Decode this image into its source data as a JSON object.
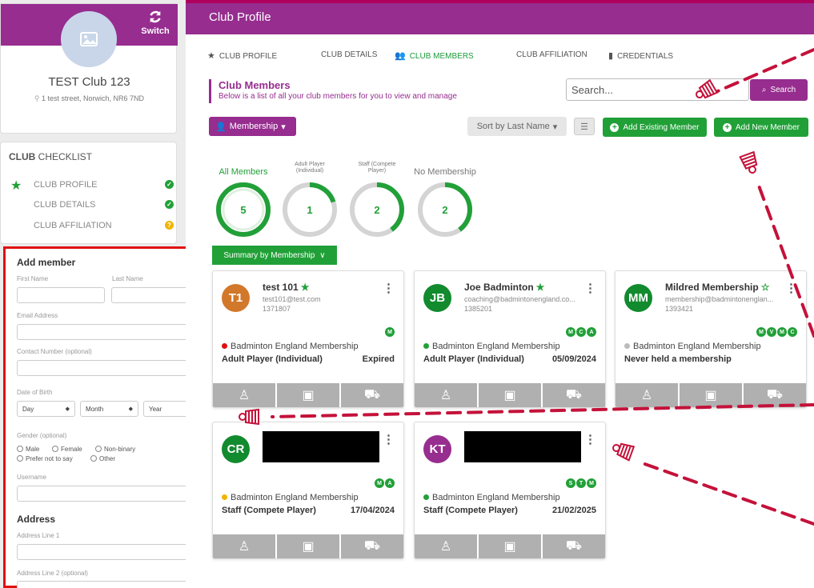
{
  "sidebar": {
    "switch_label": "Switch",
    "club_name": "TEST Club 123",
    "club_address": "1 test street, Norwich, NR6 7ND",
    "checklist_title_bold": "CLUB",
    "checklist_title_rest": " CHECKLIST",
    "checklist": [
      {
        "label": "CLUB PROFILE",
        "status": "complete"
      },
      {
        "label": "CLUB DETAILS",
        "status": "complete"
      },
      {
        "label": "CLUB AFFILIATION",
        "status": "pending"
      }
    ]
  },
  "add_member": {
    "title": "Add member",
    "first_name": "First Name",
    "last_name": "Last Name",
    "email": "Email Address",
    "contact": "Contact Number (optional)",
    "dob": "Date of Birth",
    "day": "Day",
    "month": "Month",
    "year": "Year",
    "gender": "Gender (optional)",
    "gender_options": [
      "Male",
      "Female",
      "Non-binary",
      "Prefer not to say",
      "Other"
    ],
    "username": "Username",
    "address_title": "Address",
    "address1": "Address Line 1",
    "address2": "Address Line 2 (optional)"
  },
  "header": {
    "title": "Club Profile"
  },
  "tabs": [
    {
      "label": "CLUB PROFILE",
      "icon": "star-icon",
      "active": false
    },
    {
      "label": "CLUB DETAILS",
      "icon": "",
      "active": false
    },
    {
      "label": "CLUB MEMBERS",
      "icon": "users-icon",
      "active": true
    },
    {
      "label": "CLUB AFFILIATION",
      "icon": "",
      "active": false
    },
    {
      "label": "CREDENTIALS",
      "icon": "bookmark-icon",
      "active": false
    }
  ],
  "section": {
    "title": "Club Members",
    "subtitle": "Below is a list of all your club members for you to view and manage"
  },
  "search": {
    "placeholder": "Search...",
    "button": "Search"
  },
  "toolbar": {
    "membership": "Membership",
    "sort": "Sort by Last Name",
    "add_existing": "Add Existing Member",
    "add_new": "Add New Member"
  },
  "stats": [
    {
      "label": "All Members",
      "value": "5",
      "fraction": 1.0
    },
    {
      "label": "Adult Player (Individual)",
      "value": "1",
      "fraction": 0.2
    },
    {
      "label": "Staff (Compete Player)",
      "value": "2",
      "fraction": 0.4
    },
    {
      "label": "No Membership",
      "value": "2",
      "fraction": 0.4
    }
  ],
  "summary_button": "Summary by Membership",
  "members": [
    {
      "initials": "T1",
      "avatar_color": "#d2782a",
      "name": "test 101",
      "starred": true,
      "email": "test101@test.com",
      "id": "1371807",
      "badges": [
        "M"
      ],
      "status_color": "#e01010",
      "membership": "Badminton England Membership",
      "type": "Adult Player (Individual)",
      "date": "Expired",
      "redacted": false
    },
    {
      "initials": "JB",
      "avatar_color": "#128a2e",
      "name": "Joe Badminton",
      "starred": true,
      "email": "coaching@badmintonengland.co...",
      "id": "1385201",
      "badges": [
        "M",
        "C",
        "A"
      ],
      "status_color": "#21a038",
      "membership": "Badminton England Membership",
      "type": "Adult Player (Individual)",
      "date": "05/09/2024",
      "redacted": false
    },
    {
      "initials": "MM",
      "avatar_color": "#128a2e",
      "name": "Mildred Membership",
      "starred": false,
      "email": "membership@badmintonenglan...",
      "id": "1393421",
      "badges": [
        "M",
        "V",
        "M",
        "C"
      ],
      "status_color": "#bbbbbb",
      "membership": "Badminton England Membership",
      "type": "Never held a membership",
      "date": "",
      "redacted": false
    },
    {
      "initials": "CR",
      "avatar_color": "#128a2e",
      "name": "",
      "starred": false,
      "email": "",
      "id": "",
      "badges": [
        "M",
        "A"
      ],
      "status_color": "#f0b400",
      "membership": "Badminton England Membership",
      "type": "Staff (Compete Player)",
      "date": "17/04/2024",
      "redacted": true
    },
    {
      "initials": "KT",
      "avatar_color": "#962d8f",
      "name": "",
      "starred": false,
      "email": "",
      "id": "",
      "badges": [
        "S",
        "T",
        "M"
      ],
      "status_color": "#21a038",
      "membership": "Badminton England Membership",
      "type": "Staff (Compete Player)",
      "date": "21/02/2025",
      "redacted": true
    }
  ],
  "colors": {
    "brand": "#962d8f",
    "accent_green": "#21a038",
    "annotation_red": "#c4123a"
  }
}
